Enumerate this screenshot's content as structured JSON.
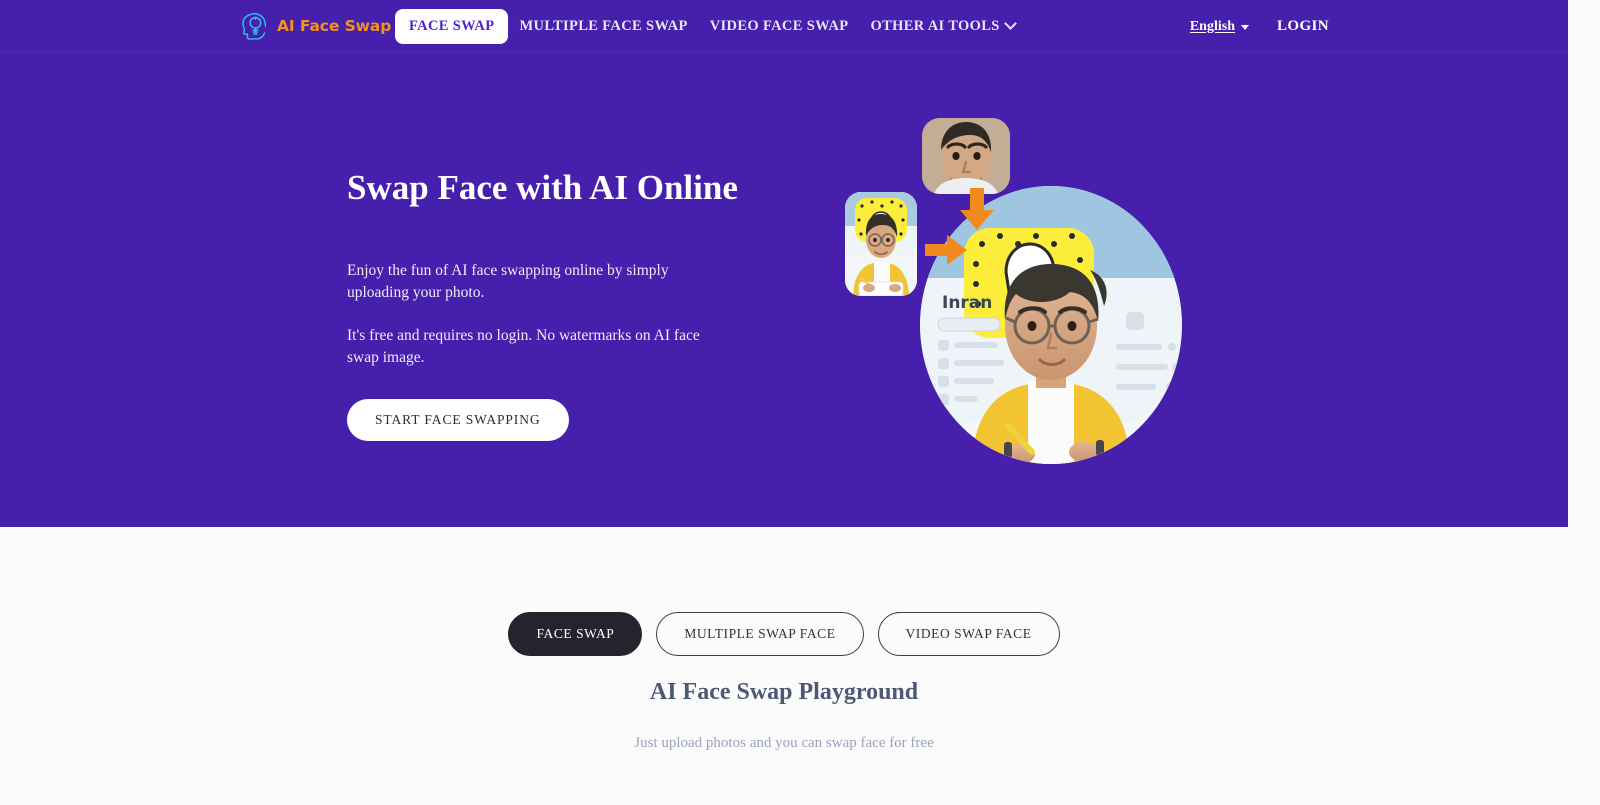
{
  "brand": {
    "name": "AI Face Swap",
    "logo_icon": "head-lightbulb-icon",
    "logo_color": "#2bc4e8",
    "text_color": "#f59120"
  },
  "header": {
    "background_color": "#4620ac",
    "nav": [
      {
        "label": "FACE SWAP",
        "active": true,
        "has_caret": false
      },
      {
        "label": "MULTIPLE FACE SWAP",
        "active": false,
        "has_caret": false
      },
      {
        "label": "VIDEO FACE SWAP",
        "active": false,
        "has_caret": false
      },
      {
        "label": "OTHER AI TOOLS",
        "active": false,
        "has_caret": true
      }
    ],
    "language": {
      "label": "English",
      "caret_icon": "chevron-down-icon"
    },
    "login_label": "LOGIN"
  },
  "hero": {
    "title": "Swap Face with AI Online",
    "paragraph_1": "Enjoy the fun of AI face swapping online by simply uploading your photo.",
    "paragraph_2": "It's free and requires no login. No watermarks on AI face swap image.",
    "cta_label": "START FACE SWAPPING",
    "art": {
      "result_username": "Inran",
      "source_icon": "source-face-thumbnail",
      "target_icon": "target-photo-thumbnail",
      "arrow_down_icon": "arrow-down-icon",
      "arrow_right_icon": "arrow-right-icon",
      "arrow_color": "#f08a1e",
      "accent_yellow": "#fced3a"
    }
  },
  "playground": {
    "tabs": [
      {
        "label": "FACE SWAP",
        "active": true
      },
      {
        "label": "MULTIPLE SWAP FACE",
        "active": false
      },
      {
        "label": "VIDEO SWAP FACE",
        "active": false
      }
    ],
    "title": "AI Face Swap Playground",
    "subtitle": "Just upload photos and you can swap face for free"
  }
}
